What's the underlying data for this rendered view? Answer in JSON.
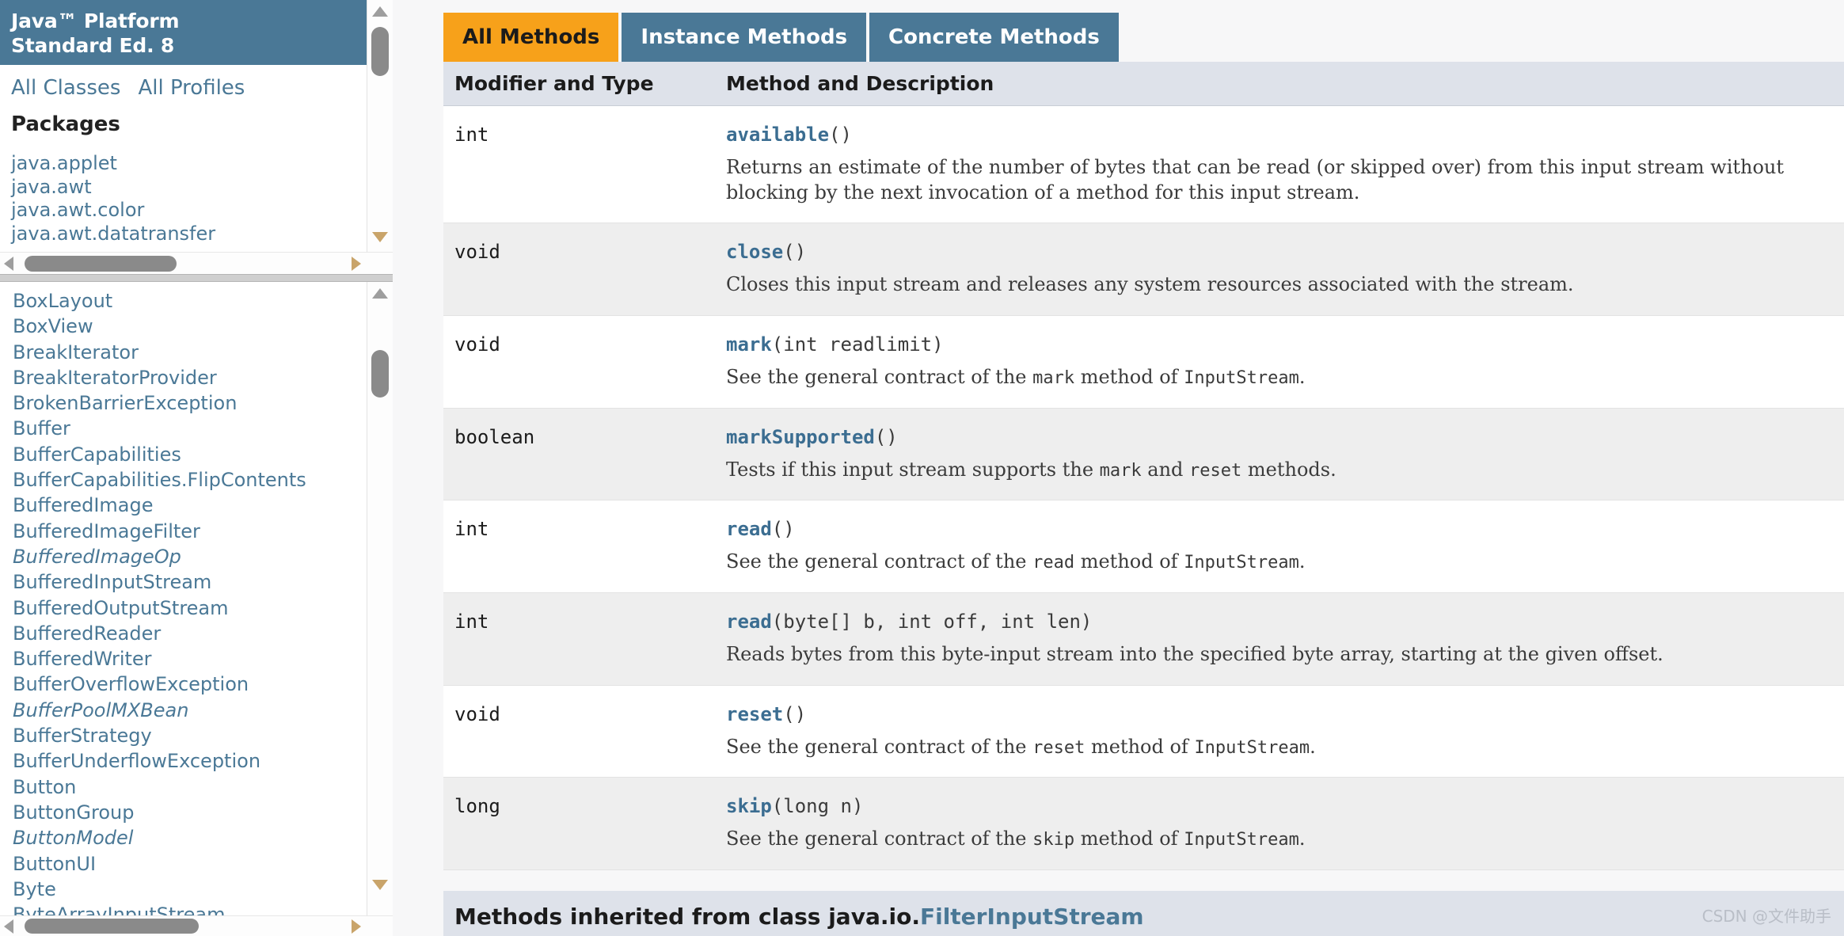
{
  "sidebar": {
    "title_line1": "Java™ Platform",
    "title_line2": "Standard Ed. 8",
    "nav": [
      {
        "label": "All Classes"
      },
      {
        "label": "All Profiles"
      }
    ],
    "packages_heading": "Packages",
    "packages": [
      {
        "label": "java.applet"
      },
      {
        "label": "java.awt"
      },
      {
        "label": "java.awt.color"
      },
      {
        "label": "java.awt.datatransfer"
      }
    ],
    "classes": [
      {
        "label": "BoxLayout",
        "kind": "class"
      },
      {
        "label": "BoxView",
        "kind": "class"
      },
      {
        "label": "BreakIterator",
        "kind": "class"
      },
      {
        "label": "BreakIteratorProvider",
        "kind": "class"
      },
      {
        "label": "BrokenBarrierException",
        "kind": "class"
      },
      {
        "label": "Buffer",
        "kind": "class"
      },
      {
        "label": "BufferCapabilities",
        "kind": "class"
      },
      {
        "label": "BufferCapabilities.FlipContents",
        "kind": "class"
      },
      {
        "label": "BufferedImage",
        "kind": "class"
      },
      {
        "label": "BufferedImageFilter",
        "kind": "class"
      },
      {
        "label": "BufferedImageOp",
        "kind": "interface"
      },
      {
        "label": "BufferedInputStream",
        "kind": "class"
      },
      {
        "label": "BufferedOutputStream",
        "kind": "class"
      },
      {
        "label": "BufferedReader",
        "kind": "class"
      },
      {
        "label": "BufferedWriter",
        "kind": "class"
      },
      {
        "label": "BufferOverflowException",
        "kind": "class"
      },
      {
        "label": "BufferPoolMXBean",
        "kind": "interface"
      },
      {
        "label": "BufferStrategy",
        "kind": "class"
      },
      {
        "label": "BufferUnderflowException",
        "kind": "class"
      },
      {
        "label": "Button",
        "kind": "class"
      },
      {
        "label": "ButtonGroup",
        "kind": "class"
      },
      {
        "label": "ButtonModel",
        "kind": "interface"
      },
      {
        "label": "ButtonUI",
        "kind": "class"
      },
      {
        "label": "Byte",
        "kind": "class"
      },
      {
        "label": "ByteArrayInputStream",
        "kind": "class"
      }
    ]
  },
  "main": {
    "tabs": [
      {
        "label": "All Methods",
        "active": true
      },
      {
        "label": "Instance Methods",
        "active": false
      },
      {
        "label": "Concrete Methods",
        "active": false
      }
    ],
    "columns": {
      "modifier_and_type": "Modifier and Type",
      "method_and_description": "Method and Description"
    },
    "methods": [
      {
        "type": "int",
        "name": "available",
        "params": "()",
        "description": [
          {
            "t": "text",
            "v": "Returns an estimate of the number of bytes that can be read (or skipped over) from this input stream without blocking by the next invocation of a method for this input stream."
          }
        ]
      },
      {
        "type": "void",
        "name": "close",
        "params": "()",
        "description": [
          {
            "t": "text",
            "v": "Closes this input stream and releases any system resources associated with the stream."
          }
        ]
      },
      {
        "type": "void",
        "name": "mark",
        "params": "(int readlimit)",
        "description": [
          {
            "t": "text",
            "v": "See the general contract of the "
          },
          {
            "t": "code",
            "v": "mark"
          },
          {
            "t": "text",
            "v": " method of "
          },
          {
            "t": "code",
            "v": "InputStream"
          },
          {
            "t": "text",
            "v": "."
          }
        ]
      },
      {
        "type": "boolean",
        "name": "markSupported",
        "params": "()",
        "description": [
          {
            "t": "text",
            "v": "Tests if this input stream supports the "
          },
          {
            "t": "code",
            "v": "mark"
          },
          {
            "t": "text",
            "v": " and "
          },
          {
            "t": "code",
            "v": "reset"
          },
          {
            "t": "text",
            "v": " methods."
          }
        ]
      },
      {
        "type": "int",
        "name": "read",
        "params": "()",
        "description": [
          {
            "t": "text",
            "v": "See the general contract of the "
          },
          {
            "t": "code",
            "v": "read"
          },
          {
            "t": "text",
            "v": " method of "
          },
          {
            "t": "code",
            "v": "InputStream"
          },
          {
            "t": "text",
            "v": "."
          }
        ]
      },
      {
        "type": "int",
        "name": "read",
        "params": "(byte[] b, int off, int len)",
        "description": [
          {
            "t": "text",
            "v": "Reads bytes from this byte-input stream into the specified byte array, starting at the given offset."
          }
        ]
      },
      {
        "type": "void",
        "name": "reset",
        "params": "()",
        "description": [
          {
            "t": "text",
            "v": "See the general contract of the "
          },
          {
            "t": "code",
            "v": "reset"
          },
          {
            "t": "text",
            "v": " method of "
          },
          {
            "t": "code",
            "v": "InputStream"
          },
          {
            "t": "text",
            "v": "."
          }
        ]
      },
      {
        "type": "long",
        "name": "skip",
        "params": "(long n)",
        "description": [
          {
            "t": "text",
            "v": "See the general contract of the "
          },
          {
            "t": "code",
            "v": "skip"
          },
          {
            "t": "text",
            "v": " method of "
          },
          {
            "t": "code",
            "v": "InputStream"
          },
          {
            "t": "text",
            "v": "."
          }
        ]
      }
    ],
    "inherited": {
      "prefix": "Methods inherited from class java.io.",
      "link": "FilterInputStream"
    }
  },
  "watermark": "CSDN @文件助手",
  "colors": {
    "header_blue": "#4a7896",
    "tab_active_orange": "#f7a11a",
    "table_header_bg": "#dee2ea",
    "row_alt_bg": "#eeeeee",
    "link_blue": "#4a7896"
  }
}
